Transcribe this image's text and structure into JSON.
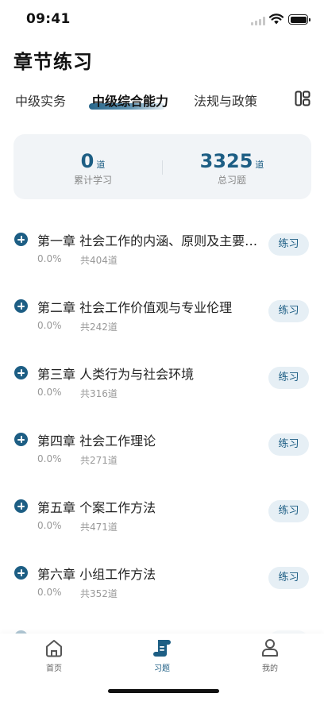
{
  "status_bar": {
    "time": "09:41"
  },
  "page_title": "章节练习",
  "tabs": [
    {
      "label": "中级实务",
      "active": false
    },
    {
      "label": "中级综合能力",
      "active": true
    },
    {
      "label": "法规与政策",
      "active": false
    }
  ],
  "stats": {
    "studied": {
      "value": "0",
      "unit": "道",
      "label": "累计学习"
    },
    "total": {
      "value": "3325",
      "unit": "道",
      "label": "总习题"
    }
  },
  "chapters": [
    {
      "title": "第一章 社会工作的内涵、原则及主要领域",
      "progress": "0.0%",
      "total": "共404道",
      "button": "练习"
    },
    {
      "title": "第二章 社会工作价值观与专业伦理",
      "progress": "0.0%",
      "total": "共242道",
      "button": "练习"
    },
    {
      "title": "第三章 人类行为与社会环境",
      "progress": "0.0%",
      "total": "共316道",
      "button": "练习"
    },
    {
      "title": "第四章 社会工作理论",
      "progress": "0.0%",
      "total": "共271道",
      "button": "练习"
    },
    {
      "title": "第五章 个案工作方法",
      "progress": "0.0%",
      "total": "共471道",
      "button": "练习"
    },
    {
      "title": "第六章 小组工作方法",
      "progress": "0.0%",
      "total": "共352道",
      "button": "练习"
    }
  ],
  "bottom_nav": [
    {
      "label": "首页",
      "icon": "home-icon",
      "active": false
    },
    {
      "label": "习题",
      "icon": "scroll-icon",
      "active": true
    },
    {
      "label": "我的",
      "icon": "user-icon",
      "active": false
    }
  ],
  "colors": {
    "accent": "#1d5e84",
    "card_bg": "#f1f4f7",
    "button_bg": "#e6eff5",
    "muted": "#999999"
  }
}
